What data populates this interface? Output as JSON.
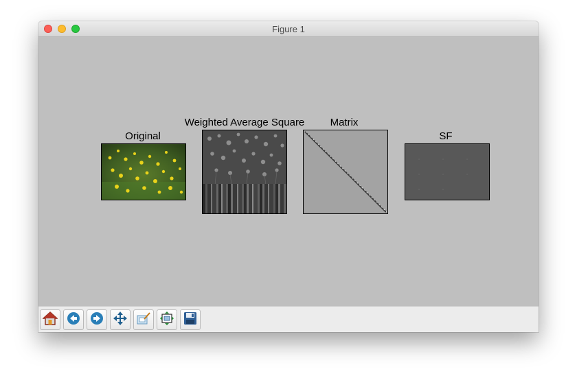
{
  "window": {
    "title": "Figure 1"
  },
  "figure": {
    "panels": [
      {
        "title": "Original",
        "image": "flower-field-photo"
      },
      {
        "title": "Weighted Average Square",
        "image": "grayscale-flower-field"
      },
      {
        "title": "Matrix",
        "image": "diagonal-matrix"
      },
      {
        "title": "SF",
        "image": "dark-gray-field"
      }
    ]
  },
  "toolbar": {
    "buttons": [
      {
        "icon": "home-icon"
      },
      {
        "icon": "back-icon"
      },
      {
        "icon": "forward-icon"
      },
      {
        "icon": "pan-icon"
      },
      {
        "icon": "zoom-icon"
      },
      {
        "icon": "configure-subplots-icon"
      },
      {
        "icon": "save-icon"
      }
    ]
  }
}
